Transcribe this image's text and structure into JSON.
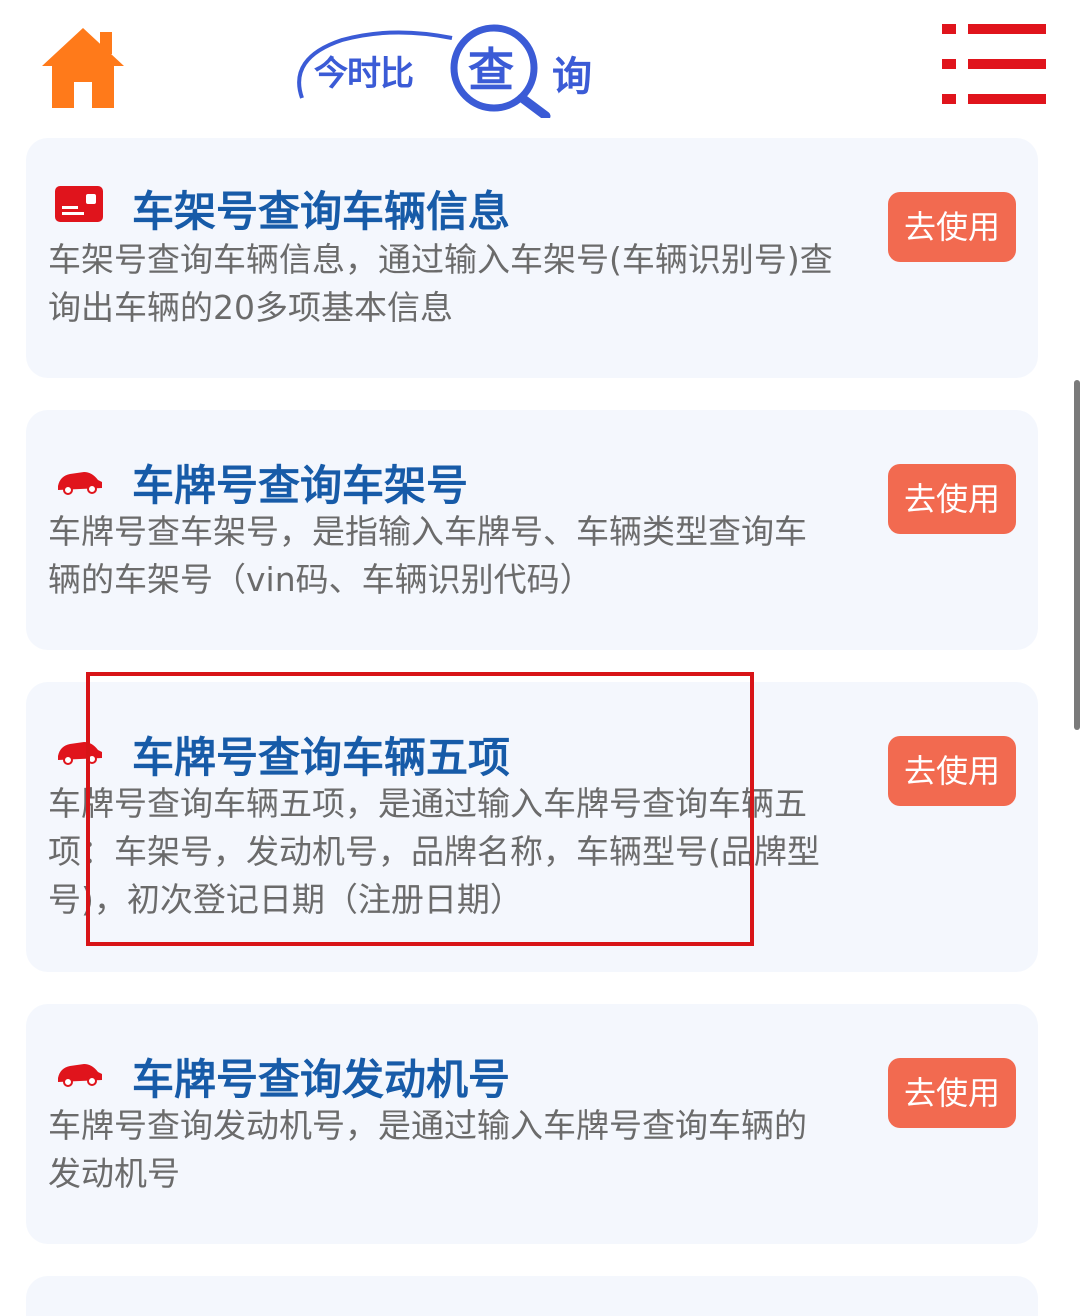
{
  "header": {
    "home_icon": "home-icon",
    "logo": {
      "text": "今时比",
      "cha": "查",
      "xun": "询"
    },
    "menu_icon": "menu-icon",
    "colors": {
      "home": "#ff7a1a",
      "logo": "#3b5bd6",
      "menu": "#e0141c"
    }
  },
  "cards": [
    {
      "icon": "id-card-icon",
      "title": "车架号查询车辆信息",
      "description": "车架号查询车辆信息，通过输入车架号(车辆识别号)查询出车辆的20多项基本信息",
      "button": "去使用"
    },
    {
      "icon": "car-icon",
      "title": "车牌号查询车架号",
      "description": "车牌号查车架号，是指输入车牌号、车辆类型查询车辆的车架号（vin码、车辆识别代码）",
      "button": "去使用"
    },
    {
      "icon": "car-icon",
      "title": "车牌号查询车辆五项",
      "description": "车牌号查询车辆五项，是通过输入车牌号查询车辆五项：车架号，发动机号，品牌名称，车辆型号(品牌型号)，初次登记日期（注册日期）",
      "button": "去使用"
    },
    {
      "icon": "car-icon",
      "title": "车牌号查询发动机号",
      "description": "车牌号查询发动机号，是通过输入车牌号查询车辆的发动机号",
      "button": "去使用"
    }
  ],
  "colors": {
    "card_bg": "#f4f7fd",
    "title": "#175ba8",
    "description": "#6b6b6b",
    "button_bg": "#f26a50",
    "highlight": "#d81418"
  }
}
